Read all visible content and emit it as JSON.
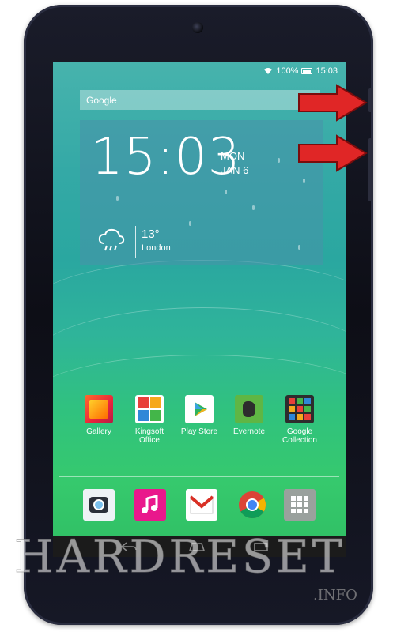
{
  "status_bar": {
    "battery": "100%",
    "time": "15:03"
  },
  "search": {
    "label": "Google"
  },
  "clock_widget": {
    "time": "15:03",
    "day": "MON",
    "date": "JAN 6",
    "temperature": "13°",
    "city": "London"
  },
  "apps": [
    {
      "label": "Gallery",
      "icon": "gallery-icon"
    },
    {
      "label": "Kingsoft Office",
      "icon": "kingsoft-office-icon"
    },
    {
      "label": "Play Store",
      "icon": "play-store-icon"
    },
    {
      "label": "Evernote",
      "icon": "evernote-icon"
    },
    {
      "label": "Google Collection",
      "icon": "google-collection-icon"
    }
  ],
  "dock": [
    "camera-icon",
    "music-icon",
    "gmail-icon",
    "chrome-icon",
    "app-drawer-icon"
  ],
  "navigation": [
    "back-icon",
    "home-icon",
    "recents-icon"
  ],
  "watermark": {
    "main": "HARDRESET",
    "sub": ".INFO"
  },
  "colors": {
    "screen_top": "#47b3ad",
    "screen_bottom": "#2fbe63",
    "arrow": "#e02626",
    "bezel": "#161826"
  }
}
